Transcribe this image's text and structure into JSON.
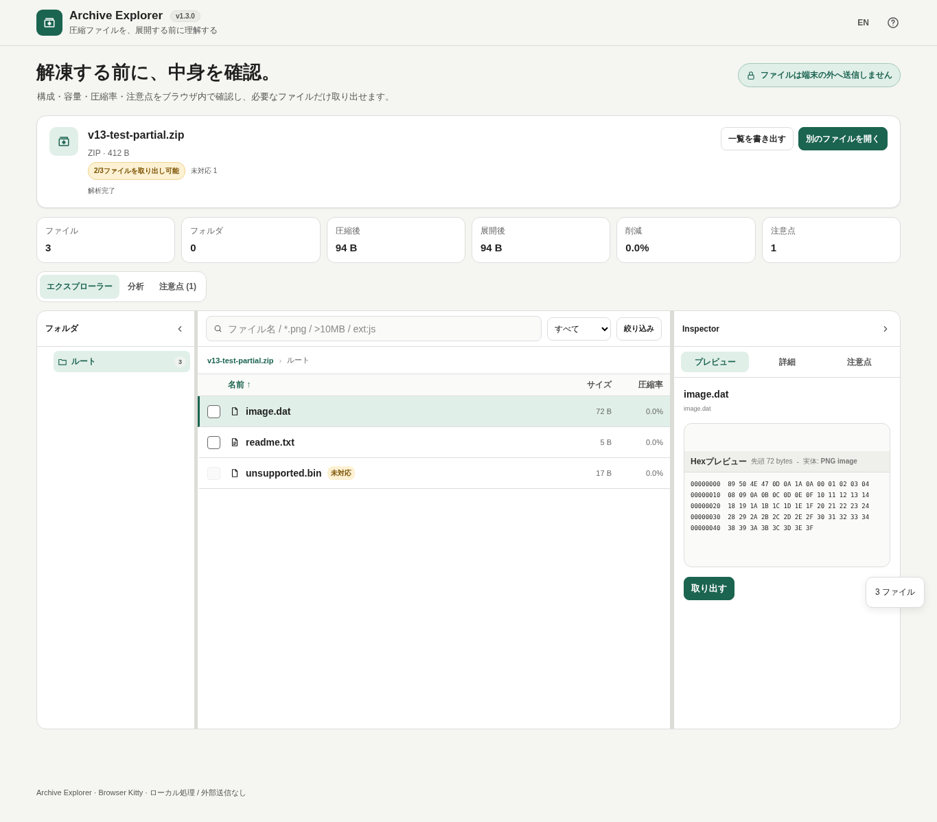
{
  "header": {
    "title": "Archive Explorer",
    "version": "v1.3.0",
    "subtitle": "圧縮ファイルを、展開する前に理解する",
    "lang": "EN"
  },
  "hero": {
    "title": "解凍する前に、中身を確認。",
    "subtitle": "構成・容量・圧縮率・注意点をブラウザ内で確認し、必要なファイルだけ取り出せます。",
    "privacy": "ファイルは端末の外へ送信しません"
  },
  "archive": {
    "name": "v13-test-partial.zip",
    "meta": "ZIP · 412 B",
    "badge": "2/3ファイルを取り出し可能",
    "note": "未対応 1",
    "status": "解析完了",
    "buttons": [
      {
        "label": "一覧を書き出す",
        "kind": "secondary"
      },
      {
        "label": "別のファイルを開く",
        "kind": "primary"
      }
    ]
  },
  "stats": [
    {
      "label": "ファイル",
      "value": "3"
    },
    {
      "label": "フォルダ",
      "value": "0"
    },
    {
      "label": "圧縮後",
      "value": "94 B"
    },
    {
      "label": "展開後",
      "value": "94 B"
    },
    {
      "label": "削減",
      "value": "0.0%"
    },
    {
      "label": "注意点",
      "value": "1"
    }
  ],
  "tabs": [
    {
      "label": "エクスプローラー",
      "selected": true
    },
    {
      "label": "分析",
      "selected": false
    },
    {
      "label": "注意点 (1)",
      "selected": false
    }
  ],
  "folders": {
    "title": "フォルダ",
    "items": [
      {
        "label": "ルート",
        "count": "3",
        "selected": true
      }
    ]
  },
  "toolbar": {
    "placeholder": "ファイル名 / *.png / >10MB / ext:js",
    "filter": "すべて",
    "filter_button": "絞り込み"
  },
  "breadcrumb_separator": "›",
  "breadcrumb": [
    {
      "label": "v13-test-partial.zip",
      "link": true
    },
    {
      "label": "ルート",
      "link": false
    }
  ],
  "columns": [
    {
      "label": "名前",
      "sort": "↑",
      "sorted": true
    },
    {
      "label": "サイズ",
      "sorted": false
    },
    {
      "label": "圧縮率",
      "sorted": false
    }
  ],
  "rows": [
    {
      "name": "image.dat",
      "kind": "file",
      "size": "72 B",
      "ratio": "0.0%",
      "selected": true,
      "checked": false,
      "disabled": false
    },
    {
      "name": "readme.txt",
      "kind": "text",
      "size": "5 B",
      "ratio": "0.0%",
      "selected": false,
      "checked": false,
      "disabled": false
    },
    {
      "name": "unsupported.bin",
      "kind": "file",
      "badge": "未対応",
      "size": "17 B",
      "ratio": "0.0%",
      "selected": false,
      "checked": false,
      "disabled": true
    }
  ],
  "inspector": {
    "title": "Inspector",
    "tabs": [
      {
        "label": "プレビュー",
        "selected": true
      },
      {
        "label": "詳細",
        "selected": false
      },
      {
        "label": "注意点",
        "selected": false
      }
    ],
    "file_title": "image.dat",
    "file_path": "image.dat",
    "hex_label": "Hexプレビュー",
    "hex_head": "先頭 72 bytes",
    "hex_sep": "-",
    "hex_type": "実体: **PNG image**",
    "hex_lines": [
      "00000000  89 50 4E 47 0D 0A 1A 0A 00 01 02 03 04",
      "00000010  08 09 0A 0B 0C 0D 0E 0F 10 11 12 13 14",
      "00000020  18 19 1A 1B 1C 1D 1E 1F 20 21 22 23 24",
      "00000030  28 29 2A 2B 2C 2D 2E 2F 30 31 32 33 34",
      "00000040  38 39 3A 3B 3C 3D 3E 3F"
    ],
    "extract_button": "取り出す"
  },
  "selection_count": "3 ファイル",
  "footer": "Archive Explorer · Browser Kitty · ローカル処理 / 外部送信なし"
}
